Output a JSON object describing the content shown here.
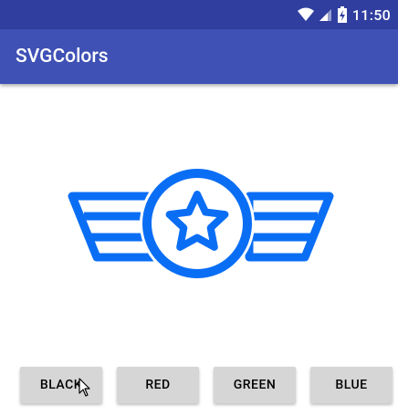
{
  "status_bar": {
    "time": "11:50",
    "icons": [
      "wifi-icon",
      "cellular-signal-icon",
      "battery-charging-icon"
    ]
  },
  "app_bar": {
    "title": "SVGColors",
    "color": "#3F51B5",
    "status_color": "#303F9F"
  },
  "emblem": {
    "icon": "winged-star-badge-icon",
    "color": "#0A6EF5"
  },
  "buttons": [
    {
      "label": "BLACK"
    },
    {
      "label": "RED"
    },
    {
      "label": "GREEN"
    },
    {
      "label": "BLUE"
    }
  ]
}
